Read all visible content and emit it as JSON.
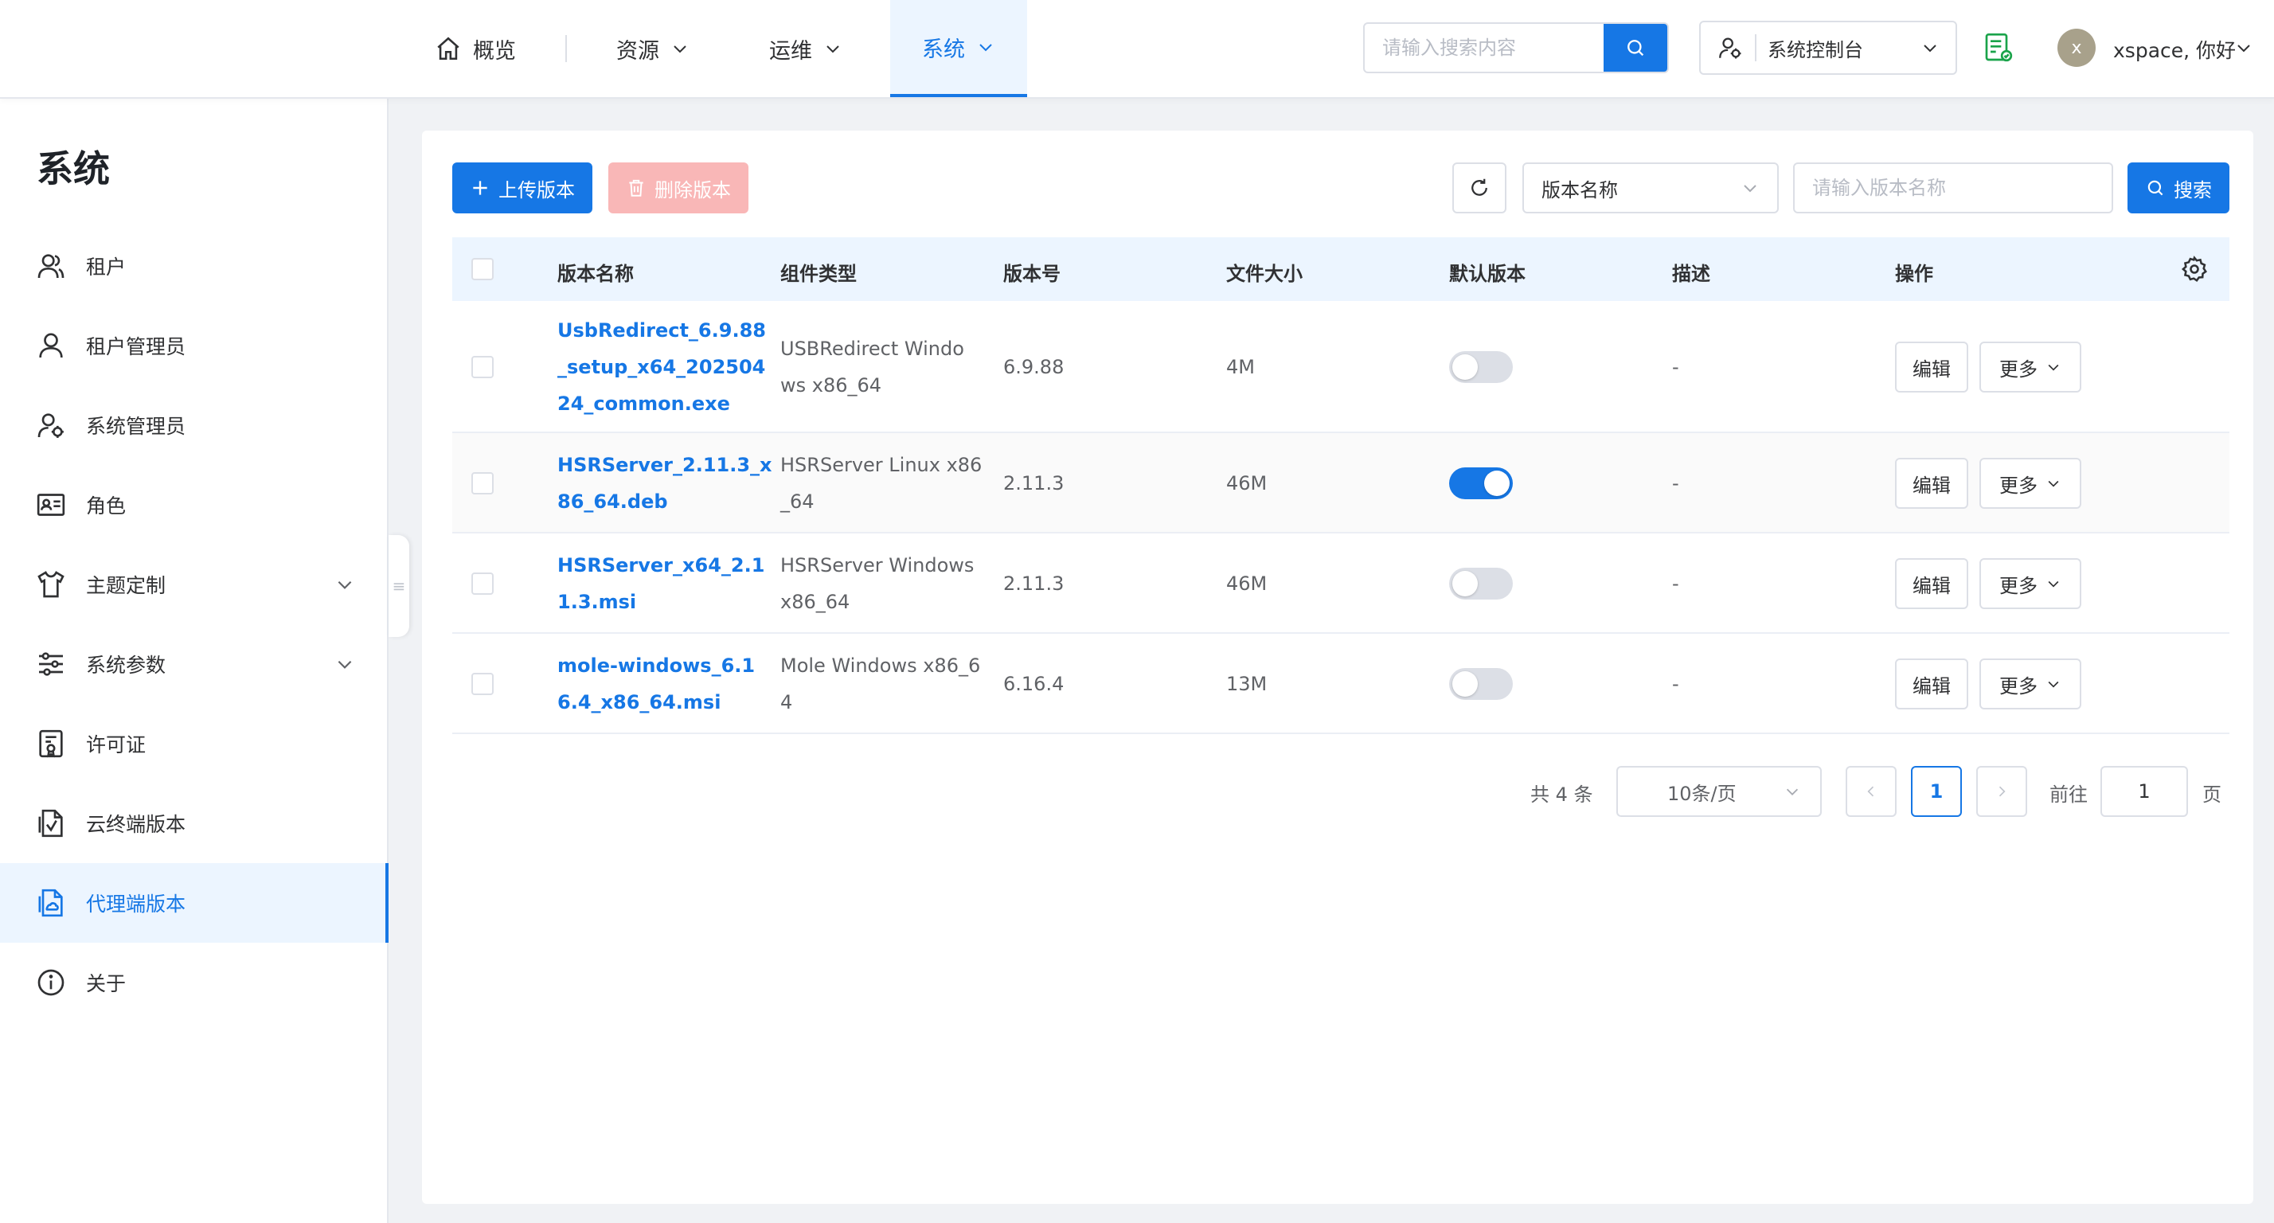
{
  "header": {
    "nav": [
      {
        "label": "概览",
        "icon": "home-icon"
      },
      {
        "label": "资源",
        "icon": "chevron-down-icon"
      },
      {
        "label": "运维",
        "icon": "chevron-down-icon"
      },
      {
        "label": "系统",
        "icon": "chevron-down-icon",
        "active": true
      }
    ],
    "search_placeholder": "请输入搜索内容",
    "console_label": "系统控制台",
    "user_initial": "x",
    "greeting": "xspace, 你好"
  },
  "sidebar": {
    "title": "系统",
    "items": [
      {
        "label": "租户",
        "icon": "users-icon"
      },
      {
        "label": "租户管理员",
        "icon": "user-icon"
      },
      {
        "label": "系统管理员",
        "icon": "user-gear-icon"
      },
      {
        "label": "角色",
        "icon": "id-card-icon"
      },
      {
        "label": "主题定制",
        "icon": "shirt-icon",
        "expandable": true
      },
      {
        "label": "系统参数",
        "icon": "sliders-icon",
        "expandable": true
      },
      {
        "label": "许可证",
        "icon": "license-icon"
      },
      {
        "label": "云终端版本",
        "icon": "file-check-icon"
      },
      {
        "label": "代理端版本",
        "icon": "file-cloud-icon",
        "active": true
      },
      {
        "label": "关于",
        "icon": "info-icon"
      }
    ]
  },
  "toolbar": {
    "upload_label": "上传版本",
    "delete_label": "删除版本",
    "filter_field": "版本名称",
    "filter_placeholder": "请输入版本名称",
    "search_label": "搜索"
  },
  "table": {
    "columns": [
      "版本名称",
      "组件类型",
      "版本号",
      "文件大小",
      "默认版本",
      "描述",
      "操作"
    ],
    "rows": [
      {
        "name": [
          "UsbRedirect_6.9.88",
          "_setup_x64_202504",
          "24_common.exe"
        ],
        "type": [
          "USBRedirect Windo",
          "ws x86_64"
        ],
        "version": "6.9.88",
        "size": "4M",
        "default": false,
        "desc": "-"
      },
      {
        "name": [
          "HSRServer_2.11.3_x",
          "86_64.deb"
        ],
        "type": [
          "HSRServer Linux x86",
          "_64"
        ],
        "version": "2.11.3",
        "size": "46M",
        "default": true,
        "desc": "-"
      },
      {
        "name": [
          "HSRServer_x64_2.1",
          "1.3.msi"
        ],
        "type": [
          "HSRServer Windows",
          "x86_64"
        ],
        "version": "2.11.3",
        "size": "46M",
        "default": false,
        "desc": "-"
      },
      {
        "name": [
          "mole-windows_6.1",
          "6.4_x86_64.msi"
        ],
        "type": [
          "Mole Windows x86_6",
          "4"
        ],
        "version": "6.16.4",
        "size": "13M",
        "default": false,
        "desc": "-"
      }
    ],
    "edit_label": "编辑",
    "more_label": "更多"
  },
  "pagination": {
    "total_text": "共 4 条",
    "page_size": "10条/页",
    "current_page": "1",
    "goto_label": "前往",
    "goto_value": "1",
    "page_suffix": "页"
  },
  "colors": {
    "primary": "#1677e5",
    "danger_disabled": "#f9b7b7",
    "header_bg": "#ecf5ff"
  }
}
